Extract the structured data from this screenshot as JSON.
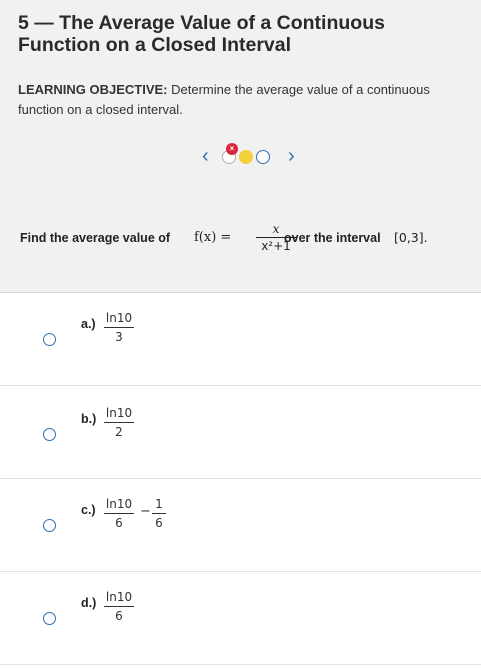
{
  "header": {
    "title": "5 — The Average Value of a Continuous Function on a Closed Interval",
    "objective_label": "LEARNING OBJECTIVE:",
    "objective_text": " Determine the average value of a continuous function on a closed interval."
  },
  "pager": {
    "prev_icon": "chevron-left-icon",
    "next_icon": "chevron-right-icon",
    "badge": "×",
    "colors": {
      "accent": "#2d6fb4",
      "current": "#f2cf3b",
      "incorrect": "#d7263d"
    }
  },
  "question": {
    "prefix": "Find the average value of",
    "function": "f(x) =",
    "numerator": "x",
    "denominator": "x²+1",
    "suffix": "over the interval",
    "interval": "[0,3]."
  },
  "options": [
    {
      "label": "a.)",
      "numerator": "ln10",
      "denominator": "3"
    },
    {
      "label": "b.)",
      "numerator": "ln10",
      "denominator": "2"
    },
    {
      "label": "c.)",
      "numerator": "ln10",
      "denominator": "6",
      "minus": "−",
      "numerator2": "1",
      "denominator2": "6"
    },
    {
      "label": "d.)",
      "numerator": "ln10",
      "denominator": "6"
    }
  ]
}
